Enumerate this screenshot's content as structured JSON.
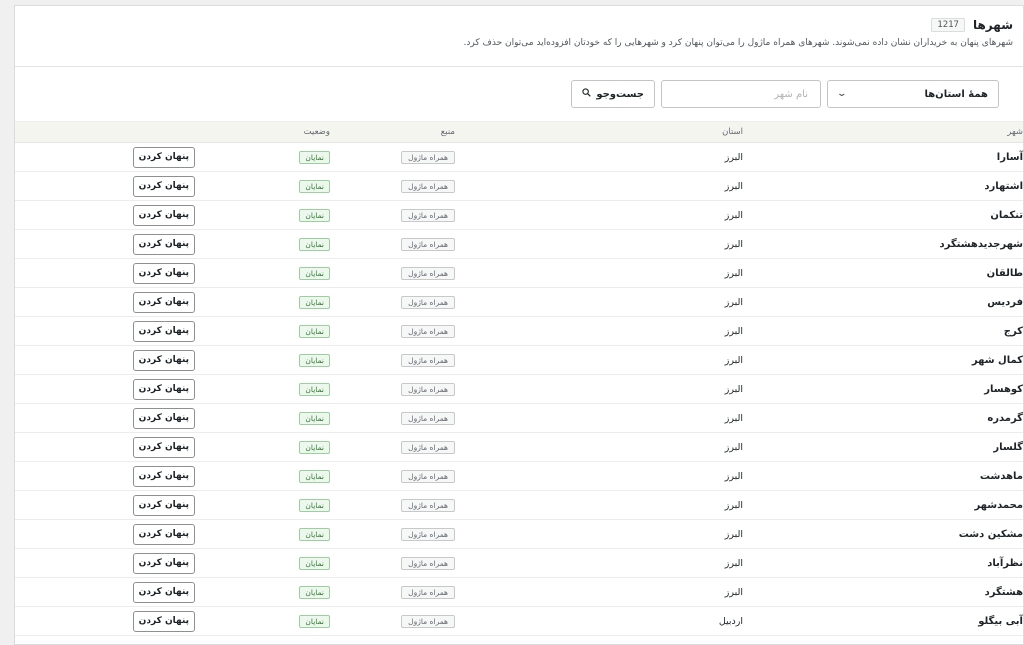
{
  "header": {
    "title": "شهرها",
    "count": "1217",
    "description": "شهرهای پنهان به خریداران نشان داده نمی‌شوند. شهرهای همراه ماژول را می‌توان پنهان کرد و شهرهایی را که خودتان افزوده‌اید می‌توان حذف کرد."
  },
  "filters": {
    "province_select": "همهٔ استان‌ها",
    "city_placeholder": "نام شهر",
    "search_label": "جست‌وجو"
  },
  "table": {
    "headers": {
      "city": "شهر",
      "province": "استان",
      "source": "منبع",
      "status": "وضعیت"
    },
    "rows": [
      {
        "city": "آسارا",
        "province": "البرز",
        "source": "همراه ماژول",
        "status": "نمایان",
        "action": "پنهان کردن"
      },
      {
        "city": "اشتهارد",
        "province": "البرز",
        "source": "همراه ماژول",
        "status": "نمایان",
        "action": "پنهان کردن"
      },
      {
        "city": "تنکمان",
        "province": "البرز",
        "source": "همراه ماژول",
        "status": "نمایان",
        "action": "پنهان کردن"
      },
      {
        "city": "شهرجدیدهشتگرد",
        "province": "البرز",
        "source": "همراه ماژول",
        "status": "نمایان",
        "action": "پنهان کردن"
      },
      {
        "city": "طالقان",
        "province": "البرز",
        "source": "همراه ماژول",
        "status": "نمایان",
        "action": "پنهان کردن"
      },
      {
        "city": "فردیس",
        "province": "البرز",
        "source": "همراه ماژول",
        "status": "نمایان",
        "action": "پنهان کردن"
      },
      {
        "city": "کرج",
        "province": "البرز",
        "source": "همراه ماژول",
        "status": "نمایان",
        "action": "پنهان کردن"
      },
      {
        "city": "کمال شهر",
        "province": "البرز",
        "source": "همراه ماژول",
        "status": "نمایان",
        "action": "پنهان کردن"
      },
      {
        "city": "کوهسار",
        "province": "البرز",
        "source": "همراه ماژول",
        "status": "نمایان",
        "action": "پنهان کردن"
      },
      {
        "city": "گرمدره",
        "province": "البرز",
        "source": "همراه ماژول",
        "status": "نمایان",
        "action": "پنهان کردن"
      },
      {
        "city": "گلسار",
        "province": "البرز",
        "source": "همراه ماژول",
        "status": "نمایان",
        "action": "پنهان کردن"
      },
      {
        "city": "ماهدشت",
        "province": "البرز",
        "source": "همراه ماژول",
        "status": "نمایان",
        "action": "پنهان کردن"
      },
      {
        "city": "محمدشهر",
        "province": "البرز",
        "source": "همراه ماژول",
        "status": "نمایان",
        "action": "پنهان کردن"
      },
      {
        "city": "مشکین دشت",
        "province": "البرز",
        "source": "همراه ماژول",
        "status": "نمایان",
        "action": "پنهان کردن"
      },
      {
        "city": "نظرآباد",
        "province": "البرز",
        "source": "همراه ماژول",
        "status": "نمایان",
        "action": "پنهان کردن"
      },
      {
        "city": "هشتگرد",
        "province": "البرز",
        "source": "همراه ماژول",
        "status": "نمایان",
        "action": "پنهان کردن"
      },
      {
        "city": "آبی بیگلو",
        "province": "اردبیل",
        "source": "همراه ماژول",
        "status": "نمایان",
        "action": "پنهان کردن"
      }
    ]
  },
  "icons": {
    "search": "search-icon",
    "dropdown": "chevron-down-icon"
  },
  "colors": {
    "visible_badge": "#2e7d32",
    "header_bg": "#f5f5f0"
  }
}
